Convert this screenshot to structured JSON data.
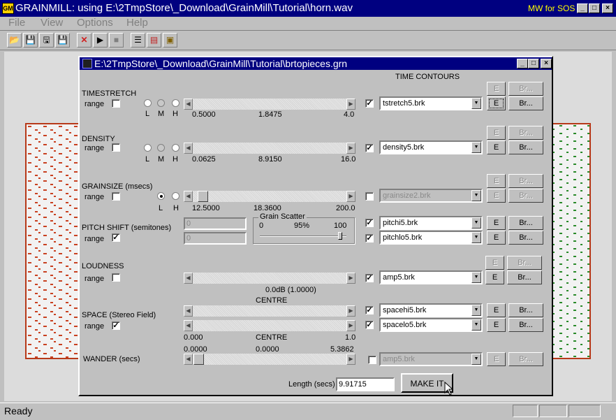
{
  "app": {
    "title": "GRAINMILL: using E:\\2TmpStore\\_Download\\GrainMill\\Tutorial\\horn.wav",
    "right_label": "MW for SOS",
    "icon_text": "GM"
  },
  "menu": [
    "File",
    "View",
    "Options",
    "Help"
  ],
  "toolbar_icons": [
    "open-icon",
    "save-icon",
    "save-as-icon",
    "save-all-icon",
    "delete-icon",
    "play-icon",
    "stop-icon",
    "list-icon",
    "graph-icon",
    "export-icon"
  ],
  "status": {
    "text": "Ready"
  },
  "dialog": {
    "title": "E:\\2TmpStore\\_Download\\GrainMill\\Tutorial\\brtopieces.grn",
    "time_contours_label": "TIME CONTOURS",
    "range_label": "range",
    "timestretch": {
      "label": "TIMESTRETCH",
      "radios": [
        "L",
        "M",
        "H"
      ],
      "min": "0.5000",
      "mid": "1.8475",
      "max": "4.0",
      "contour": "tstretch5.brk"
    },
    "density": {
      "label": "DENSITY",
      "radios": [
        "L",
        "M",
        "H"
      ],
      "min": "0.0625",
      "mid": "8.9150",
      "max": "16.0",
      "contour": "density5.brk"
    },
    "grainsize": {
      "label": "GRAINSIZE  (msecs)",
      "radios": [
        "L",
        "H"
      ],
      "min": "12.5000",
      "mid": "18.3600",
      "max": "200.0",
      "contour": "grainsize2.brk"
    },
    "pitchshift": {
      "label": "PITCH SHIFT  (semitones)",
      "value1": "0",
      "value2": "0",
      "contour_hi": "pitchi5.brk",
      "contour_lo": "pitchlo5.brk",
      "scatter": {
        "label": "Grain Scatter",
        "min": "0",
        "value": "95%",
        "max": "100"
      }
    },
    "loudness": {
      "label": "LOUDNESS",
      "value": "0.0dB (1.0000)",
      "contour": "amp5.brk"
    },
    "space": {
      "label": "SPACE (Stereo  Field)",
      "centre_label": "CENTRE",
      "min": "0.000",
      "centre": "CENTRE",
      "max": "1.0",
      "contour_hi": "spacehi5.brk",
      "contour_lo": "spacelo5.brk"
    },
    "wander": {
      "label": "WANDER (secs)",
      "min": "0.0000",
      "mid": "0.0000",
      "max": "5.3862",
      "contour": "amp5.brk"
    },
    "length_label": "Length (secs)",
    "length_value": "9.91715",
    "make_it": "MAKE IT",
    "e_label": "E",
    "br_label": "Br..."
  }
}
